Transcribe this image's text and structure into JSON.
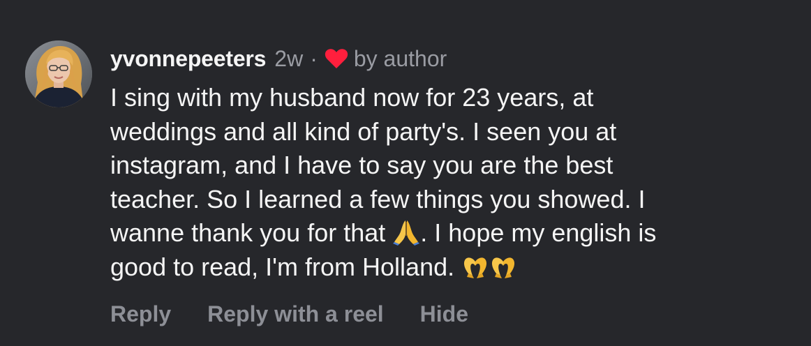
{
  "comment": {
    "username": "yvonnepeeters",
    "time": "2w",
    "separator": "·",
    "liked_by_author_label": "by author",
    "text_parts": [
      "I sing with my husband now for 23 years, at\nweddings and all kind of party's. I seen you at\ninstagram, and I have to say you are the best\nteacher.  So I learned a few things you showed.  I\nwanne thank you for that ",
      ". I hope my english is\ngood to read, I'm from Holland. "
    ],
    "emojis": [
      "folded-hands-emoji",
      "heart-hands-emoji"
    ]
  },
  "actions": {
    "reply": "Reply",
    "reply_with_reel": "Reply with a reel",
    "hide": "Hide"
  },
  "colors": {
    "background": "#26272b",
    "text": "#f5f5f5",
    "secondary_text": "#9a9ca3",
    "heart": "#ff1f3d"
  }
}
